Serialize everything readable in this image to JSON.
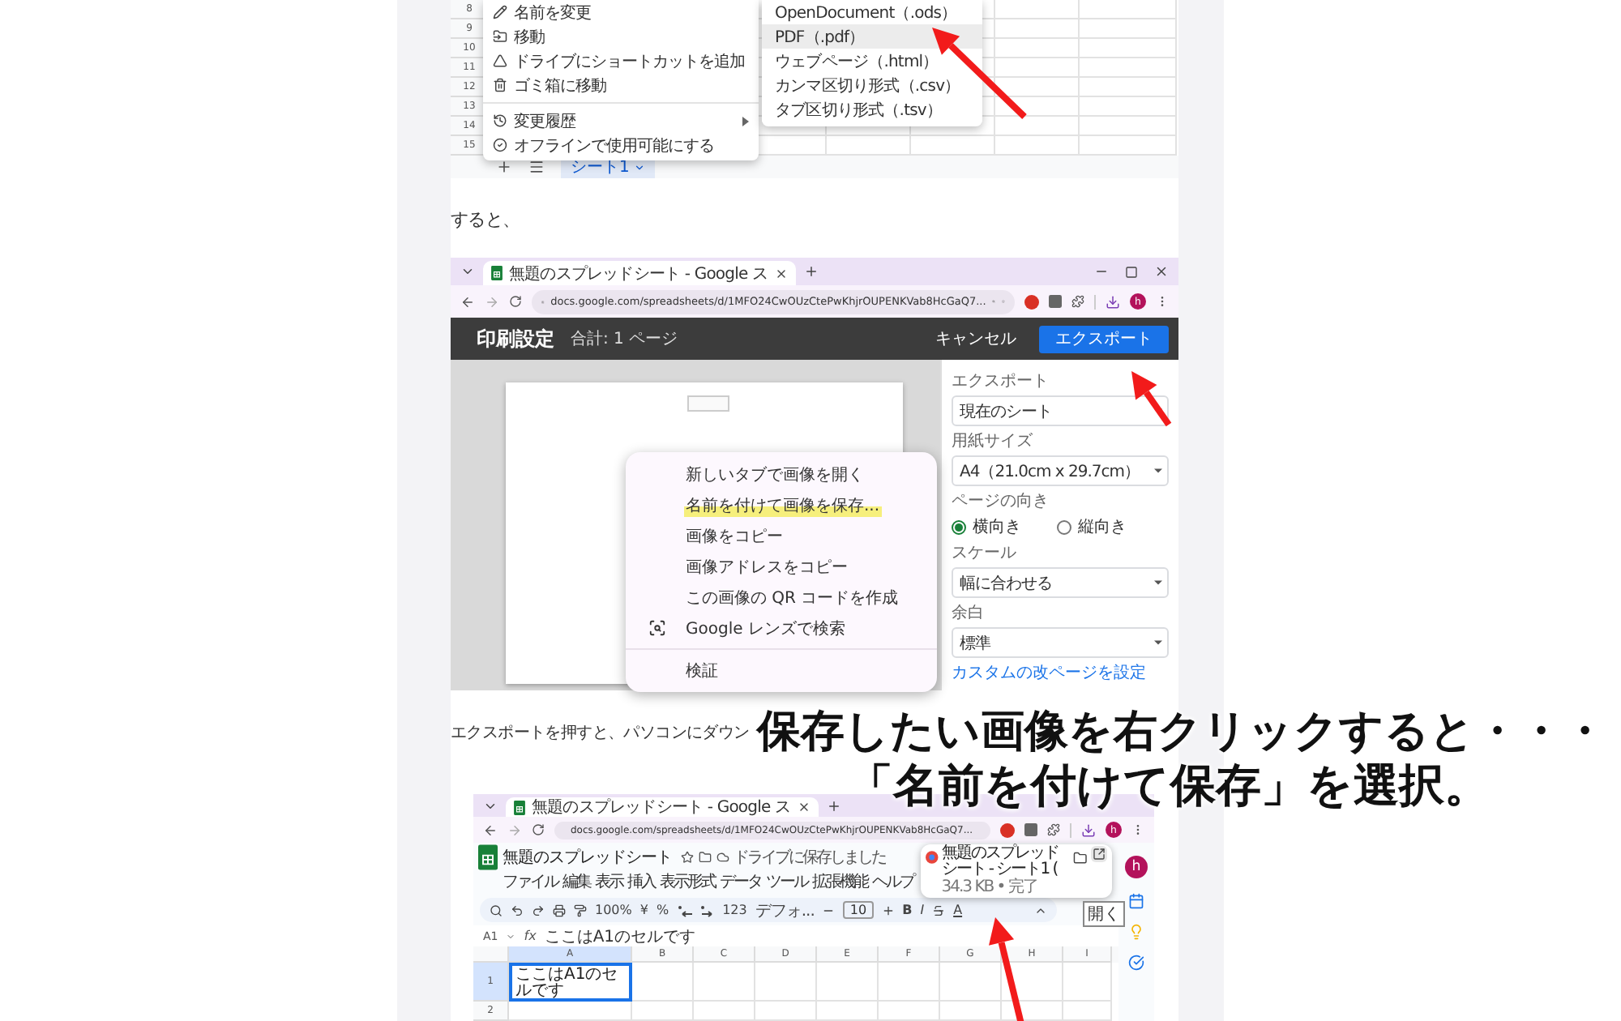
{
  "sheet_menu_shot": {
    "row_numbers": [
      "8",
      "9",
      "10",
      "11",
      "12",
      "13",
      "14",
      "15"
    ],
    "file_menu": [
      [
        {
          "kind": "rename",
          "label": "名前を変更",
          "has_submenu": false
        },
        {
          "kind": "move",
          "label": "移動",
          "has_submenu": false
        },
        {
          "kind": "shortcut",
          "label": "ドライブにショートカットを追加",
          "has_submenu": false
        },
        {
          "kind": "trash",
          "label": "ゴミ箱に移動",
          "has_submenu": false
        }
      ],
      [
        {
          "kind": "history",
          "label": "変更履歴",
          "has_submenu": true
        },
        {
          "kind": "offline",
          "label": "オフラインで使用可能にする",
          "has_submenu": false
        }
      ]
    ],
    "download_menu": [
      {
        "label": "OpenDocument（.ods）",
        "selected": false
      },
      {
        "label": "PDF（.pdf）",
        "selected": true
      },
      {
        "label": "ウェブページ（.html）",
        "selected": false
      },
      {
        "label": "カンマ区切り形式（.csv）",
        "selected": false
      },
      {
        "label": "タブ区切り形式（.tsv）",
        "selected": false
      }
    ],
    "sheet_tab": {
      "label": "シート1",
      "selected": true
    }
  },
  "paragraph_1": "すると、",
  "print_shot": {
    "tab_title": "無題のスプレッドシート - Google ス",
    "url": "docs.google.com/spreadsheets/d/1MFO24CwOUzCtePwKhjrOUPENKVab8HcGaQ7...",
    "profile_initial": "h",
    "header": {
      "title": "印刷設定",
      "page_count": "合計: 1 ページ",
      "cancel": "キャンセル",
      "export": "エクスポート"
    },
    "settings": [
      {
        "kind": "select",
        "label": "エクスポート",
        "value": "現在のシート"
      },
      {
        "kind": "select",
        "label": "用紙サイズ",
        "value": "A4（21.0cm x 29.7cm）"
      },
      {
        "kind": "radio",
        "label": "ページの向き",
        "options": [
          {
            "label": "横向き",
            "selected": true
          },
          {
            "label": "縦向き",
            "selected": false
          }
        ]
      },
      {
        "kind": "select",
        "label": "スケール",
        "value": "幅に合わせる"
      },
      {
        "kind": "select",
        "label": "余白",
        "value": "標準"
      },
      {
        "kind": "link",
        "label": "カスタムの改ページを設定"
      }
    ],
    "context_menu": [
      [
        {
          "kind": "plain",
          "label": "新しいタブで画像を開く",
          "highlighted": false
        },
        {
          "kind": "plain",
          "label": "名前を付けて画像を保存...",
          "highlighted": true
        },
        {
          "kind": "plain",
          "label": "画像をコピー",
          "highlighted": false
        },
        {
          "kind": "plain",
          "label": "画像アドレスをコピー",
          "highlighted": false
        },
        {
          "kind": "plain",
          "label": "この画像の QR コードを作成",
          "highlighted": false
        },
        {
          "kind": "lens",
          "label": "Google レンズで検索",
          "highlighted": false
        }
      ],
      [
        {
          "kind": "plain",
          "label": "検証",
          "highlighted": false
        }
      ]
    ]
  },
  "paragraph_2": "エクスポートを押すと、パソコンにダウン",
  "download_shot": {
    "tab_title": "無題のスプレッドシート - Google ス",
    "url": "docs.google.com/spreadsheets/d/1MFO24CwOUzCtePwKhjrOUPENKVab8HcGaQ7...",
    "profile_initial": "h",
    "doc_title": "無題のスプレッドシート",
    "save_status": "ドライブに保存しました",
    "menus": [
      "ファイル",
      "編集",
      "表示",
      "挿入",
      "表示形式",
      "データ",
      "ツール",
      "拡張機能",
      "ヘルプ"
    ],
    "toolbar": {
      "zoom": "100%",
      "currency": "¥",
      "percent": "%",
      "number_format": "123",
      "font": "デフォ...",
      "font_size": "10",
      "bold": "B",
      "italic": "I",
      "text_color": "A"
    },
    "download_popup": {
      "file": "無題のスプレッドシート - シート1 (",
      "status": "34.3 KB • 完了",
      "tooltip": "開く"
    },
    "cell_ref": "A1",
    "formula_label": "fx",
    "formula": "ここはA1のセルです",
    "columns": [
      {
        "label": "A",
        "selected": true
      },
      {
        "label": "B",
        "selected": false
      },
      {
        "label": "C",
        "selected": false
      },
      {
        "label": "D",
        "selected": false
      },
      {
        "label": "E",
        "selected": false
      },
      {
        "label": "F",
        "selected": false
      },
      {
        "label": "G",
        "selected": false
      },
      {
        "label": "H",
        "selected": false
      },
      {
        "label": "I",
        "selected": false
      }
    ],
    "rows": [
      {
        "number": "1",
        "selected": true,
        "cell": "ここはA1のセルです"
      },
      {
        "number": "2",
        "selected": false
      }
    ],
    "account_initial": "h"
  },
  "caption": [
    "保存したい画像を右クリックすると・・・",
    "「名前を付けて保存」を選択。"
  ]
}
